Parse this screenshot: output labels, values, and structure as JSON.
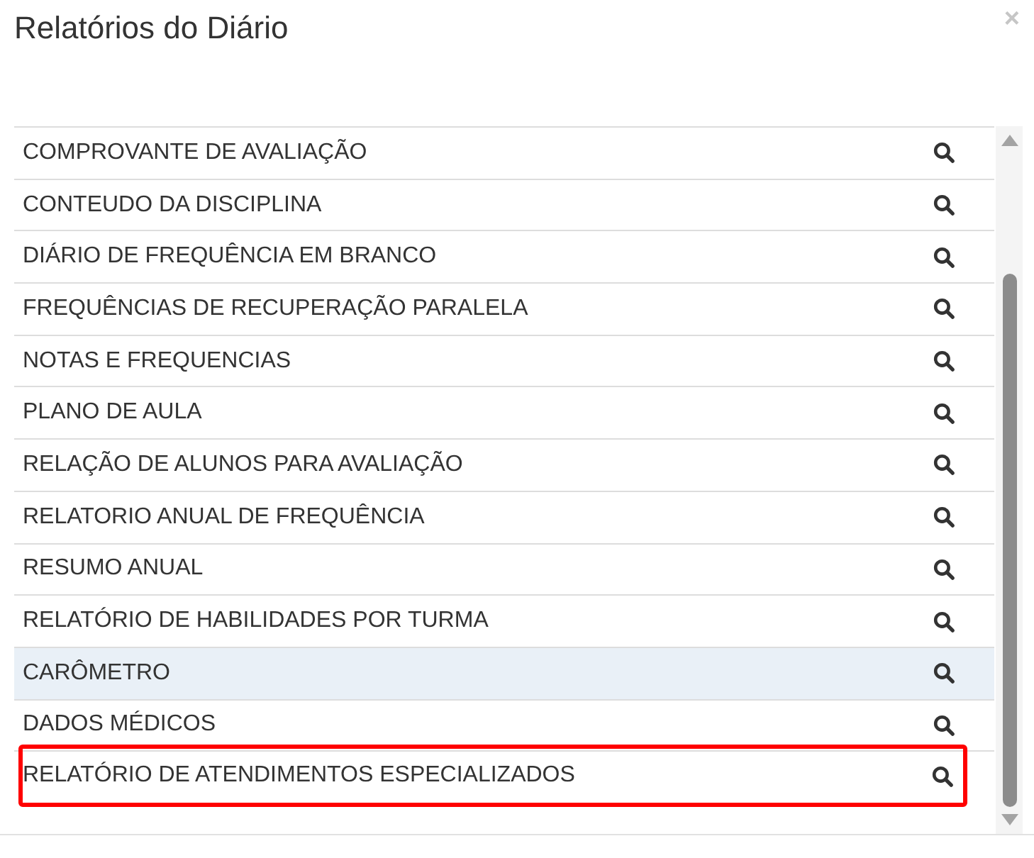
{
  "dialog": {
    "title": "Relatórios do Diário",
    "close": "×"
  },
  "reports": [
    {
      "name": "COMPROVANTE DE AVALIAÇÃO",
      "hovered": false,
      "outlined": false
    },
    {
      "name": "CONTEUDO DA DISCIPLINA",
      "hovered": false,
      "outlined": false
    },
    {
      "name": "DIÁRIO DE FREQUÊNCIA EM BRANCO",
      "hovered": false,
      "outlined": false
    },
    {
      "name": "FREQUÊNCIAS DE RECUPERAÇÃO PARALELA",
      "hovered": false,
      "outlined": false
    },
    {
      "name": "NOTAS E FREQUENCIAS",
      "hovered": false,
      "outlined": false
    },
    {
      "name": "PLANO DE AULA",
      "hovered": false,
      "outlined": false
    },
    {
      "name": "RELAÇÃO DE ALUNOS PARA AVALIAÇÃO",
      "hovered": false,
      "outlined": false
    },
    {
      "name": "RELATORIO ANUAL DE FREQUÊNCIA",
      "hovered": false,
      "outlined": false
    },
    {
      "name": "RESUMO ANUAL",
      "hovered": false,
      "outlined": false
    },
    {
      "name": "RELATÓRIO DE HABILIDADES POR TURMA",
      "hovered": false,
      "outlined": false
    },
    {
      "name": "CARÔMETRO",
      "hovered": true,
      "outlined": false
    },
    {
      "name": "DADOS MÉDICOS",
      "hovered": false,
      "outlined": false
    },
    {
      "name": "RELATÓRIO DE ATENDIMENTOS ESPECIALIZADOS",
      "hovered": false,
      "outlined": true
    }
  ]
}
